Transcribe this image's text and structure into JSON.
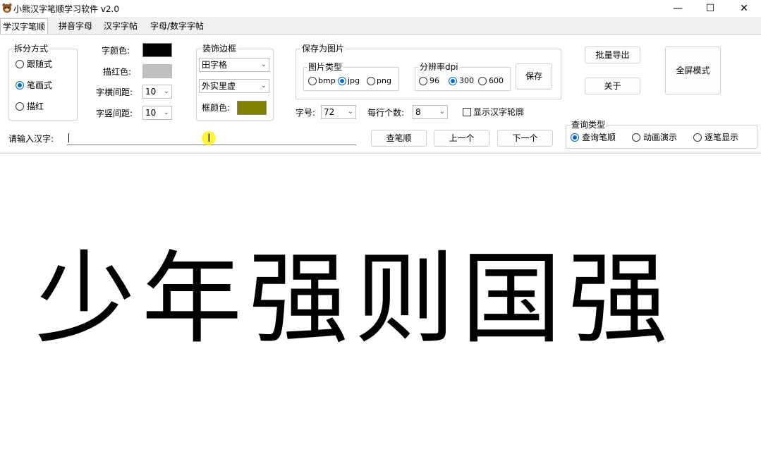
{
  "window": {
    "title": "小熊汉字笔顺学习软件 v2.0",
    "minimize": "—",
    "maximize": "☐",
    "close": "✕"
  },
  "tabs": [
    "学汉字笔顺",
    "拼音字母",
    "汉字字帖",
    "字母/数字字帖"
  ],
  "split_group": {
    "title": "拆分方式",
    "options": [
      "跟随式",
      "笔画式",
      "描红"
    ],
    "selected": "笔画式"
  },
  "colors": {
    "char_color_label": "字颜色:",
    "char_color": "#000000",
    "trace_color_label": "描红色:",
    "trace_color": "#c0c0c0",
    "frame_color_label": "框颜色:",
    "frame_color": "#7f7f00"
  },
  "spacing": {
    "h_label": "字横间距:",
    "h_value": "10",
    "v_label": "字竖间距:",
    "v_value": "10"
  },
  "border_group": {
    "title": "装饰边框",
    "grid_type": "田字格",
    "line_style": "外实里虚"
  },
  "save_group": {
    "title": "保存为图片",
    "type_title": "图片类型",
    "types": [
      "bmp",
      "jpg",
      "png"
    ],
    "type_selected": "jpg",
    "dpi_title": "分辨率dpi",
    "dpis": [
      "96",
      "300",
      "600"
    ],
    "dpi_selected": "300",
    "save_button": "保存"
  },
  "font_size": {
    "label": "字号:",
    "value": "72"
  },
  "per_row": {
    "label": "每行个数:",
    "value": "8"
  },
  "outline_checkbox": {
    "label": "显示汉字轮廓",
    "checked": false
  },
  "buttons": {
    "batch_export": "批量导出",
    "about": "关于",
    "fullscreen": "全屏模式",
    "lookup": "查笔顺",
    "prev": "上一个",
    "next": "下一个"
  },
  "input": {
    "label": "请输入汉字:",
    "value": ""
  },
  "query_group": {
    "title": "查询类型",
    "options": [
      "查询笔顺",
      "动画演示",
      "逐笔显示"
    ],
    "selected": "查询笔顺"
  },
  "display_text": "少年强则国强"
}
